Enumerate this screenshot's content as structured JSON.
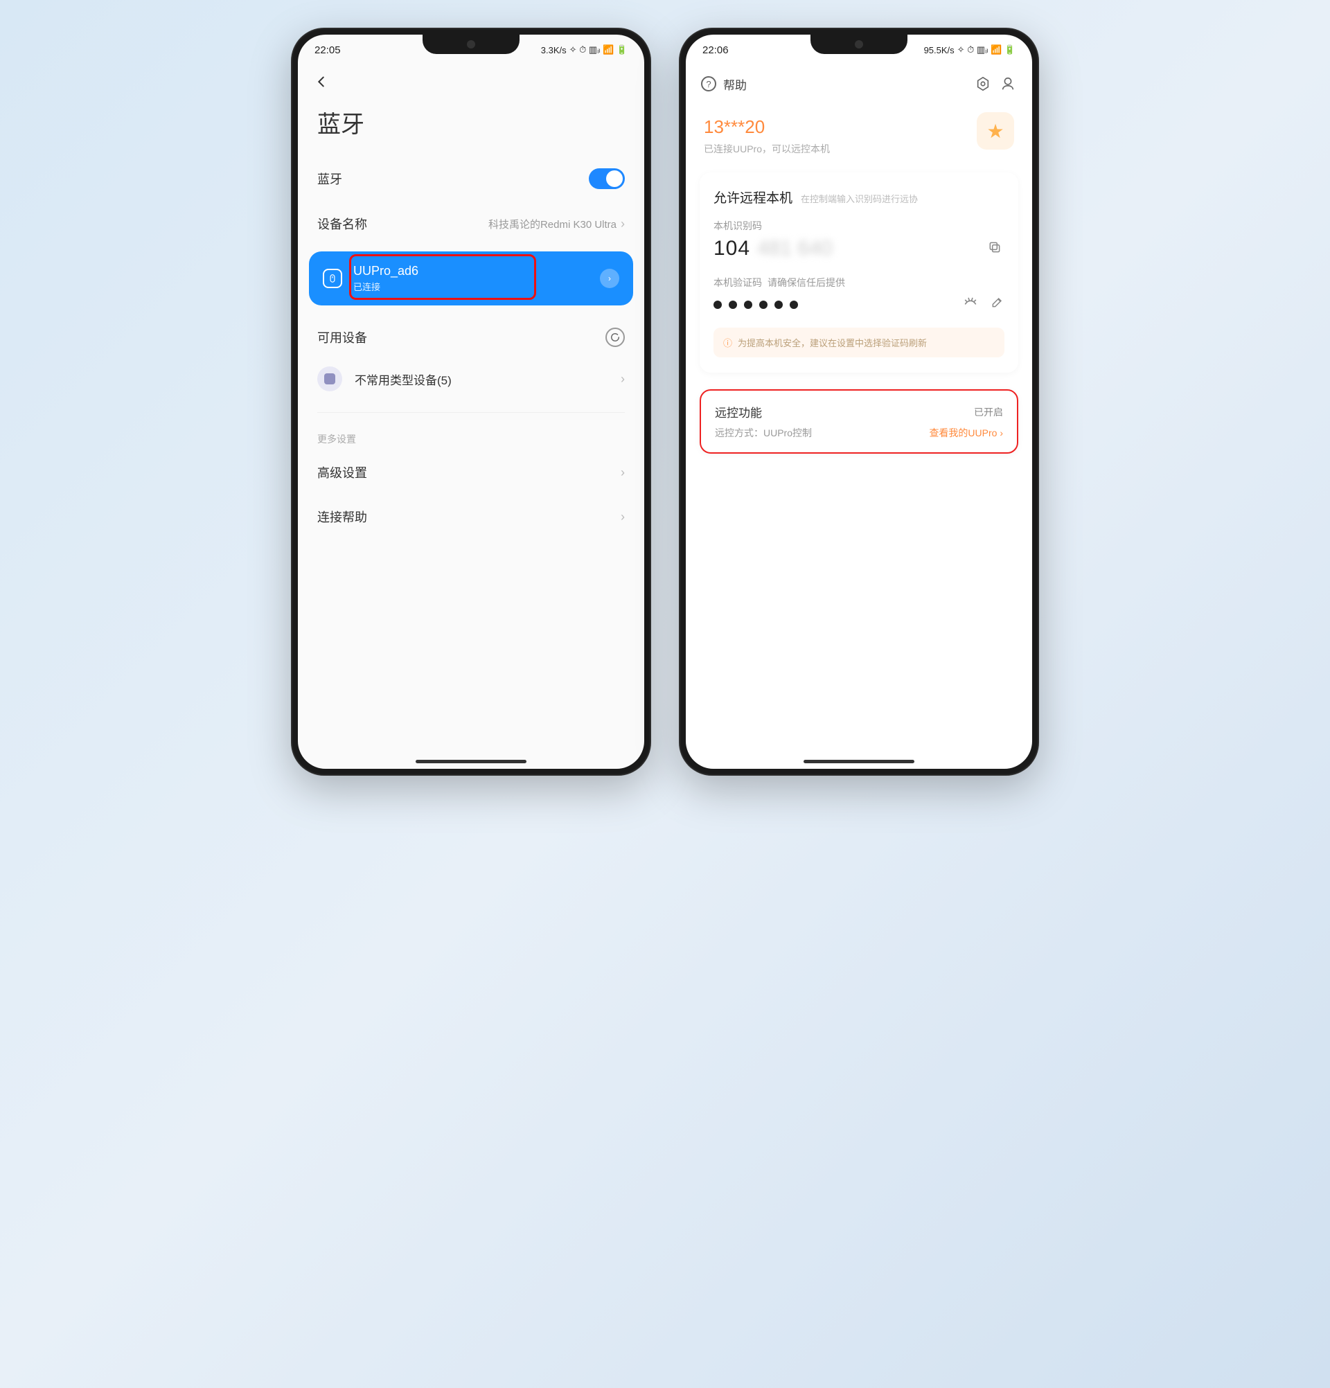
{
  "left": {
    "status": {
      "time": "22:05",
      "net": "3.3K/s",
      "iconset": "✧ ⏱ ▥ᵢₗ 📶 🔋"
    },
    "title": "蓝牙",
    "bt_toggle_label": "蓝牙",
    "device_name_label": "设备名称",
    "device_name_value": "科技禹论的Redmi K30 Ultra",
    "connected_device": {
      "name": "UUPro_ad6",
      "status": "已连接"
    },
    "available_label": "可用设备",
    "uncommon_label": "不常用类型设备(5)",
    "more_label": "更多设置",
    "advanced_label": "高级设置",
    "help_label": "连接帮助"
  },
  "right": {
    "status": {
      "time": "22:06",
      "net": "95.5K/s",
      "iconset": "✧ ⏱ ▥ᵢₗ 📶 🔋"
    },
    "help": "帮助",
    "account_num": "13***20",
    "account_desc": "已连接UUPro，可以远控本机",
    "allow_title": "允许远程本机",
    "allow_hint": "在控制端输入识别码进行远协",
    "id_label": "本机识别码",
    "id_visible": "104",
    "id_hidden": "481 640",
    "code_label": "本机验证码",
    "code_hint": "请确保信任后提供",
    "warn_text": "为提高本机安全，建议在设置中选择验证码刷新",
    "remote_title": "远控功能",
    "remote_status": "已开启",
    "remote_method": "远控方式：UUPro控制",
    "remote_link": "查看我的UUPro ›"
  }
}
